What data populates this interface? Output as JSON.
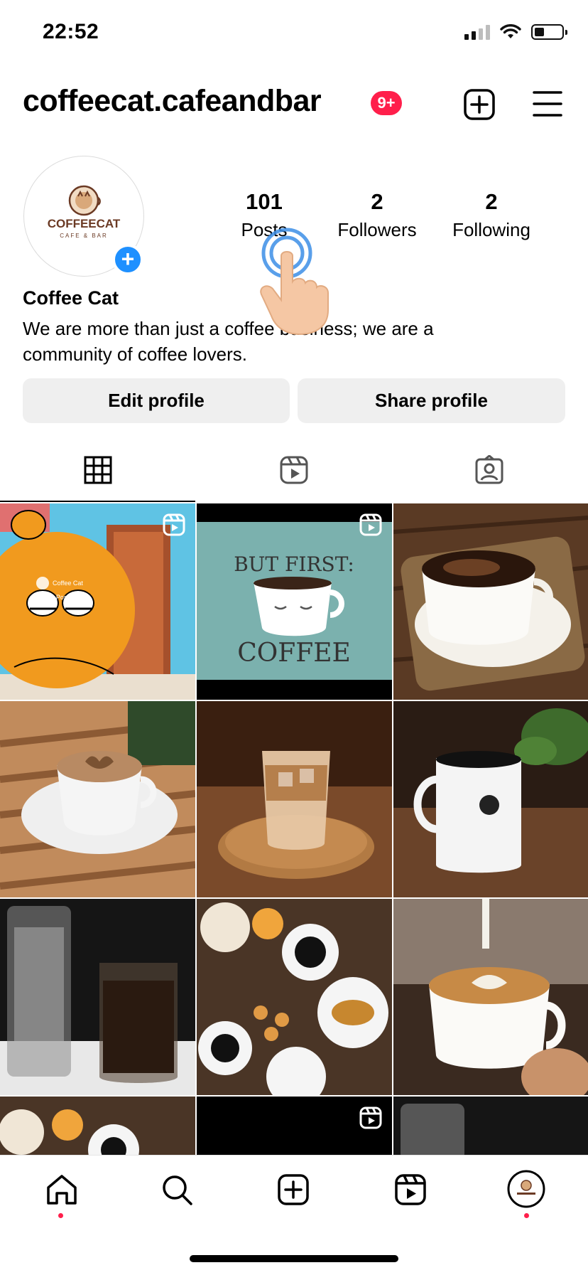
{
  "status_bar": {
    "time": "22:52"
  },
  "header": {
    "handle": "coffeecat.cafeandbar",
    "notification_badge": "9+"
  },
  "avatar": {
    "logo_text": "COFFEECAT",
    "logo_subtext": "CAFE & BAR"
  },
  "stats": [
    {
      "count": "101",
      "label": "Posts"
    },
    {
      "count": "2",
      "label": "Followers"
    },
    {
      "count": "2",
      "label": "Following"
    }
  ],
  "profile": {
    "display_name": "Coffee Cat",
    "bio": "We are more than just a coffee business; we are a community of coffee lovers."
  },
  "buttons": {
    "edit": "Edit profile",
    "share": "Share profile"
  },
  "posts": [
    {
      "subject": "garfield-cartoon",
      "reel": true,
      "overlay_name": "Coffee Cat",
      "overlay_caption": "Coffee Post"
    },
    {
      "subject": "but-first-coffee-illustration",
      "reel": true,
      "text_top": "BUT FIRST:",
      "text_bottom": "COFFEE"
    },
    {
      "subject": "espresso-cup-on-wood",
      "reel": false
    },
    {
      "subject": "cappuccino-hearts",
      "reel": false
    },
    {
      "subject": "iced-latte",
      "reel": false
    },
    {
      "subject": "white-mug-black-coffee",
      "reel": false
    },
    {
      "subject": "aeropress-coffee",
      "reel": false
    },
    {
      "subject": "breakfast-table",
      "reel": false
    },
    {
      "subject": "latte-art-pour",
      "reel": false
    },
    {
      "subject": "breakfast-table-partial",
      "reel": false
    },
    {
      "subject": "dark-reel",
      "reel": true
    },
    {
      "subject": "aeropress-partial",
      "reel": false
    }
  ],
  "colors": {
    "accent_blue": "#1e90ff",
    "badge_red": "#ff1f4b",
    "button_bg": "#efefef"
  },
  "icons": [
    "new-post-icon",
    "menu-icon",
    "grid-icon",
    "reels-icon",
    "tagged-icon",
    "home-icon",
    "search-icon",
    "create-icon",
    "reels-nav-icon",
    "profile-avatar-icon",
    "tap-hand-icon"
  ]
}
